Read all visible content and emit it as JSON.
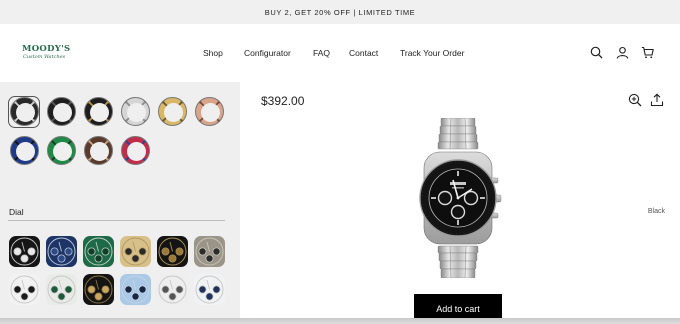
{
  "announcement": "BUY 2, GET 20% OFF | LIMITED TIME",
  "brand": {
    "name": "MOODY'S",
    "tagline": "Custom Watches",
    "color": "#2c6a4c"
  },
  "nav": [
    {
      "label": "Shop"
    },
    {
      "label": "Configurator"
    },
    {
      "label": "FAQ"
    },
    {
      "label": "Contact"
    },
    {
      "label": "Track Your Order"
    }
  ],
  "header_icons": [
    "search-icon",
    "account-icon",
    "cart-icon"
  ],
  "bezels": [
    {
      "name": "black-silver",
      "ring": "#2a2a2a",
      "accent": "#cfcfcf",
      "selected": true
    },
    {
      "name": "black",
      "ring": "#1e1e1e",
      "accent": "#555555"
    },
    {
      "name": "black-gold",
      "ring": "#1e1e1e",
      "accent": "#b8953e"
    },
    {
      "name": "silver",
      "ring": "#d5d5d5",
      "accent": "#8a8a8a"
    },
    {
      "name": "gold",
      "ring": "#d8b867",
      "accent": "#6b5526"
    },
    {
      "name": "rose-gold",
      "ring": "#d9a48a",
      "accent": "#7a4a36"
    },
    {
      "name": "blue-black",
      "ring": "#1f3a8a",
      "accent": "#111111"
    },
    {
      "name": "green",
      "ring": "#1f8a45",
      "accent": "#0f3d22"
    },
    {
      "name": "brown",
      "ring": "#5a3a2a",
      "accent": "#c9a98a"
    },
    {
      "name": "red-blue",
      "ring": "#c22d4a",
      "accent": "#2a3d9a"
    }
  ],
  "dial_section": {
    "label": "Dial",
    "value": "Black"
  },
  "dials": [
    {
      "name": "black-white-subdials",
      "face": "#151515",
      "sub": "#e8e8e8",
      "ring": "#c0c0c0"
    },
    {
      "name": "blue",
      "face": "#1d3566",
      "sub": "#2c4a85",
      "ring": "#b8c2d6"
    },
    {
      "name": "green",
      "face": "#1c6b46",
      "sub": "#0f3f29",
      "ring": "#c0c8c2"
    },
    {
      "name": "champagne",
      "face": "#d8c08a",
      "sub": "#2a2a2a",
      "ring": "#b29a64"
    },
    {
      "name": "black-gold",
      "face": "#141414",
      "sub": "#9a7b3a",
      "ring": "#a88d4f"
    },
    {
      "name": "grey-meteorite",
      "face": "#9a9588",
      "sub": "#2c2c2c",
      "ring": "#c8c4b8"
    },
    {
      "name": "white-black-subdials",
      "face": "#f2f2f2",
      "sub": "#1a1a1a",
      "ring": "#c8c8c8"
    },
    {
      "name": "white-green",
      "face": "#e8ebe8",
      "sub": "#1d5a3a",
      "ring": "#c8c8c8"
    },
    {
      "name": "black-gold-2",
      "face": "#141414",
      "sub": "#c8a860",
      "ring": "#8a7340"
    },
    {
      "name": "ice-blue",
      "face": "#a9c9e6",
      "sub": "#1a2540",
      "ring": "#c4d4e2"
    },
    {
      "name": "white-grey",
      "face": "#eeeeee",
      "sub": "#555555",
      "ring": "#c8c8c8"
    },
    {
      "name": "white-blue",
      "face": "#f0f2f4",
      "sub": "#22325a",
      "ring": "#c8c8c8"
    }
  ],
  "product": {
    "price": "$392.00"
  },
  "product_icons": [
    "zoom-in-icon",
    "share-icon"
  ],
  "cart_button": "Add to cart"
}
